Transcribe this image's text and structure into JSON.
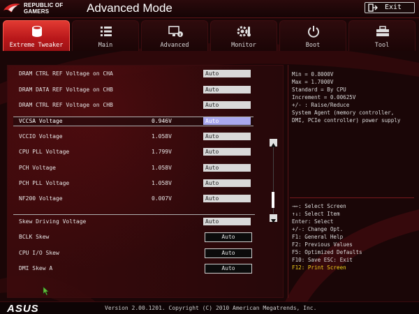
{
  "header": {
    "brand_line1": "REPUBLIC OF",
    "brand_line2": "GAMERS",
    "title": "Advanced Mode",
    "exit_label": "Exit"
  },
  "tabs": [
    {
      "label": "Extreme Tweaker",
      "icon": "cylinder-icon",
      "active": true
    },
    {
      "label": "Main",
      "icon": "list-icon",
      "active": false
    },
    {
      "label": "Advanced",
      "icon": "monitor-info-icon",
      "active": false
    },
    {
      "label": "Monitor",
      "icon": "gear-thermometer-icon",
      "active": false
    },
    {
      "label": "Boot",
      "icon": "power-icon",
      "active": false
    },
    {
      "label": "Tool",
      "icon": "toolbox-icon",
      "active": false
    }
  ],
  "settings": [
    {
      "label": "DRAM CTRL REF Voltage on CHA",
      "current": "",
      "value": "Auto"
    },
    {
      "label": "DRAM DATA REF Voltage on CHB",
      "current": "",
      "value": "Auto"
    },
    {
      "label": "DRAM CTRL REF Voltage on CHB",
      "current": "",
      "value": "Auto"
    },
    {
      "label": "VCCSA Voltage",
      "current": "0.946V",
      "value": "Auto",
      "selected": true
    },
    {
      "label": "VCCIO Voltage",
      "current": "1.058V",
      "value": "Auto"
    },
    {
      "label": "CPU PLL Voltage",
      "current": "1.799V",
      "value": "Auto"
    },
    {
      "label": "PCH Voltage",
      "current": "1.058V",
      "value": "Auto"
    },
    {
      "label": "PCH PLL Voltage",
      "current": "1.058V",
      "value": "Auto"
    },
    {
      "label": "NF200 Voltage",
      "current": "0.007V",
      "value": "Auto"
    },
    {
      "label": "Skew Driving Voltage",
      "current": "",
      "value": "Auto"
    },
    {
      "label": "BCLK Skew",
      "current": "",
      "value": "Auto",
      "style": "button"
    },
    {
      "label": "CPU I/O Skew",
      "current": "",
      "value": "Auto",
      "style": "button"
    },
    {
      "label": "DMI Skew A",
      "current": "",
      "value": "Auto",
      "style": "button"
    }
  ],
  "help": {
    "lines": [
      "Min = 0.8000V",
      "Max = 1.7000V",
      "Standard = By CPU",
      "Increment = 0.00625V",
      "+/- : Raise/Reduce",
      "System Agent (memory controller,",
      "DMI, PCIe controller) power supply"
    ],
    "keys": [
      "→←: Select Screen",
      "↑↓: Select Item",
      "Enter: Select",
      "+/-: Change Opt.",
      "F1: General Help",
      "F2: Previous Values",
      "F5: Optimized Defaults",
      "F10: Save  ESC: Exit",
      "F12: Print Screen"
    ],
    "highlight_color": "#f4d21a"
  },
  "footer": {
    "logo": "ASUS",
    "version": "Version 2.00.1201. Copyright (C) 2010 American Megatrends, Inc."
  },
  "colors": {
    "active_tab": "#c8201f",
    "selected_value_bg": "#a9a8ee",
    "background": "#1a0607"
  }
}
